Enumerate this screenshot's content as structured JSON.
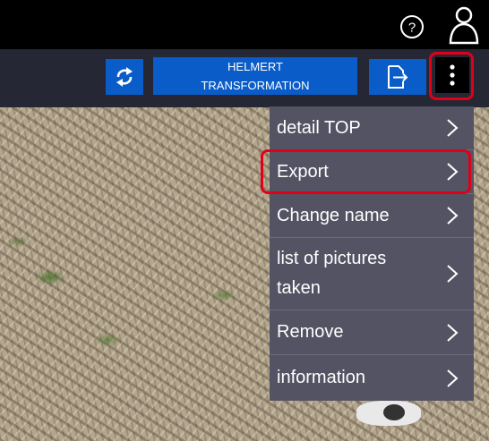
{
  "topbar": {
    "help_icon": "help-circle-icon",
    "user_icon": "user-icon"
  },
  "toolbar": {
    "sync_icon": "sync-icon",
    "helmert_line1": "HELMERT",
    "helmert_line2": "TRANSFORMATION",
    "export_icon": "file-export-icon",
    "more_icon": "more-vertical-icon"
  },
  "menu": {
    "items": [
      {
        "label": "detail TOP"
      },
      {
        "label": "Export"
      },
      {
        "label": "Change name"
      },
      {
        "label": "list of pictures taken"
      },
      {
        "label": "Remove"
      },
      {
        "label": "information"
      }
    ],
    "chevron_icon": "chevron-right-icon"
  },
  "colors": {
    "accent_blue": "#0a5cc8",
    "highlight_red": "#e0001a",
    "menu_bg": "#545363",
    "toolbar_bg": "#252834"
  }
}
